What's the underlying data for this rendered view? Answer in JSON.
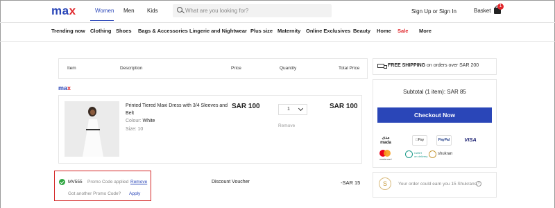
{
  "header": {
    "logo": "max",
    "gender_tabs": [
      {
        "label": "Women",
        "active": true
      },
      {
        "label": "Men",
        "active": false
      },
      {
        "label": "Kids",
        "active": false
      }
    ],
    "search_placeholder": "What are you looking for?",
    "signup_label": "Sign Up or Sign In",
    "basket_label": "Basket",
    "basket_count": "1"
  },
  "nav": {
    "items": [
      "Trending now",
      "Clothing",
      "Shoes",
      "Bags & Accessories",
      "Lingerie and Nightwear",
      "Plus size",
      "Maternity",
      "Online Exclusives",
      "Beauty",
      "Home",
      "Sale",
      "More"
    ]
  },
  "cart": {
    "headers": {
      "item": "Item",
      "description": "Description",
      "price": "Price",
      "quantity": "Quantity",
      "total": "Total Price"
    },
    "brand": "max",
    "product": {
      "title": "Printed Tiered Maxi Dress with 3/4 Sleeves and Belt",
      "colour_label": "Colour:",
      "colour_value": "White",
      "size_label": "Size:",
      "size_value": "10",
      "price": "SAR 100",
      "quantity": "1",
      "remove_label": "Remove",
      "total": "SAR 100"
    },
    "promo": {
      "code": "MV555",
      "applied_text": "Promo Code applied",
      "remove_label": "Remove",
      "another_text": "Got another Promo Code?",
      "apply_label": "Apply"
    },
    "discount": {
      "label": "Discount Voucher",
      "value": "-SAR 15"
    }
  },
  "summary": {
    "shipping_bold": "FREE SHIPPING",
    "shipping_rest": "on orders over SAR 200",
    "subtotal": "Subtotal (1 item):  SAR 85",
    "checkout_label": "Checkout Now",
    "payment_methods": {
      "mada_ar": "مدى",
      "mada_en": "mada",
      "apple_pay": "Pay",
      "paypal": "PayPal",
      "visa": "VISA",
      "mastercard": "mastercard",
      "cash_line1": "CASH",
      "cash_line2": "on delivery",
      "shukran": "shukran"
    },
    "earn_text": "Your order could earn you 15 Shukrans.",
    "earn_icon": "S",
    "info_icon": "?"
  },
  "colors": {
    "brand_blue": "#2a46b8",
    "brand_red": "#e0262b",
    "promo_border": "#d32424",
    "success_green": "#2ea640"
  }
}
